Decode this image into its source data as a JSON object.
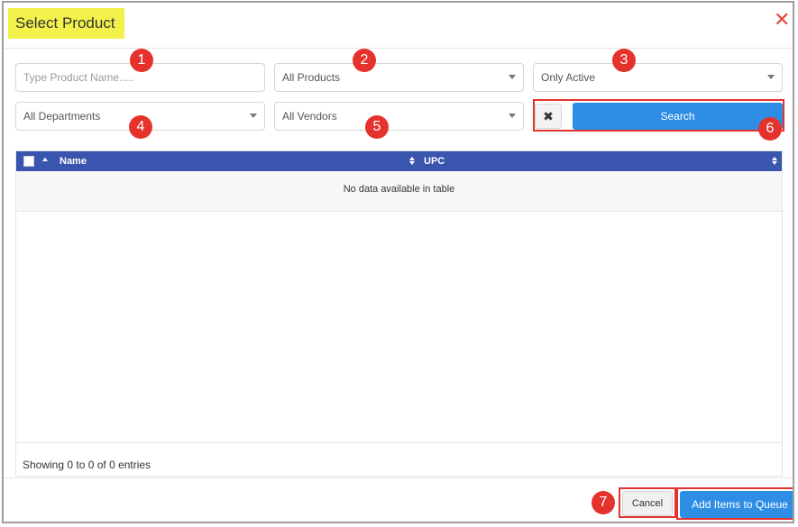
{
  "dialog": {
    "title": "Select Product",
    "close_label": "✕"
  },
  "filters": {
    "product_name": {
      "value": "",
      "placeholder": "Type Product Name....."
    },
    "product_scope": {
      "selected": "All Products"
    },
    "status": {
      "selected": "Only Active"
    },
    "department": {
      "selected": "All Departments"
    },
    "vendor": {
      "selected": "All Vendors"
    },
    "clear_label": "✖",
    "search_label": "Search"
  },
  "table": {
    "columns": [
      "Name",
      "UPC"
    ],
    "empty_message": "No data available in table",
    "info": "Showing 0 to 0 of 0 entries"
  },
  "footer": {
    "cancel_label": "Cancel",
    "add_label": "Add Items to Queue"
  },
  "callouts": [
    "1",
    "2",
    "3",
    "4",
    "5",
    "6",
    "7"
  ],
  "colors": {
    "accent": "#2e8ee6",
    "table_header": "#3a55ae",
    "callout": "#e5322d",
    "title_highlight": "#f2f24a"
  }
}
